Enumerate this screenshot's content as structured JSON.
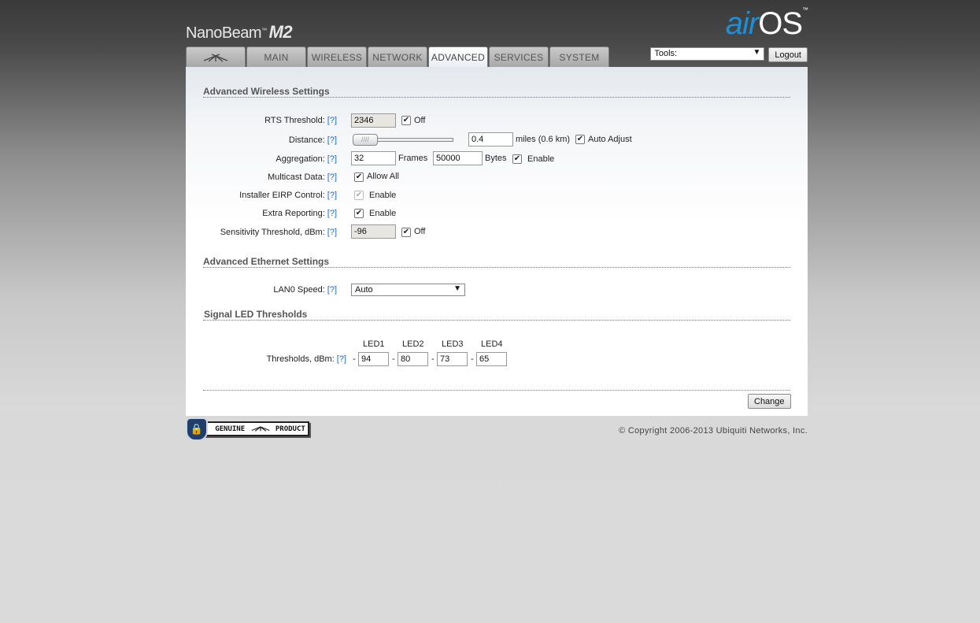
{
  "header": {
    "product": "NanoBeam",
    "product_tm": "™",
    "product_suffix": "M2",
    "logo_air": "air",
    "logo_os": "OS",
    "logo_tm": "™"
  },
  "tabs": [
    {
      "label": "",
      "icon": "ubiquiti-logo-icon"
    },
    {
      "label": "MAIN"
    },
    {
      "label": "WIRELESS"
    },
    {
      "label": "NETWORK"
    },
    {
      "label": "ADVANCED",
      "active": true
    },
    {
      "label": "SERVICES"
    },
    {
      "label": "SYSTEM"
    }
  ],
  "tools": {
    "select_value": "Tools:",
    "logout_label": "Logout"
  },
  "help": "[?]",
  "advanced_wireless": {
    "title": "Advanced Wireless Settings",
    "rts": {
      "label": "RTS Threshold:",
      "value": "2346",
      "cb_label": "Off"
    },
    "distance": {
      "label": "Distance:",
      "value": "0.4",
      "unit": "miles (0.6 km)",
      "cb_label": "Auto Adjust"
    },
    "aggregation": {
      "label": "Aggregation:",
      "frames": "32",
      "frames_label": "Frames",
      "bytes": "50000",
      "bytes_label": "Bytes",
      "cb_label": "Enable"
    },
    "multicast": {
      "label": "Multicast Data:",
      "cb_label": "Allow All"
    },
    "eirp": {
      "label": "Installer EIRP Control:",
      "cb_label": "Enable"
    },
    "extra": {
      "label": "Extra Reporting:",
      "cb_label": "Enable"
    },
    "sensitivity": {
      "label": "Sensitivity Threshold, dBm:",
      "value": "-96",
      "cb_label": "Off"
    }
  },
  "advanced_ethernet": {
    "title": "Advanced Ethernet Settings",
    "lan0": {
      "label": "LAN0 Speed:",
      "value": "Auto"
    }
  },
  "led": {
    "title": "Signal LED Thresholds",
    "label": "Thresholds, dBm:",
    "headers": [
      "LED1",
      "LED2",
      "LED3",
      "LED4"
    ],
    "values": [
      "94",
      "80",
      "73",
      "65"
    ],
    "dash": "-"
  },
  "change_label": "Change",
  "footer": {
    "genuine": "GENUINE",
    "product": "PRODUCT",
    "copyright": "© Copyright 2006-2013 Ubiquiti Networks, Inc."
  }
}
